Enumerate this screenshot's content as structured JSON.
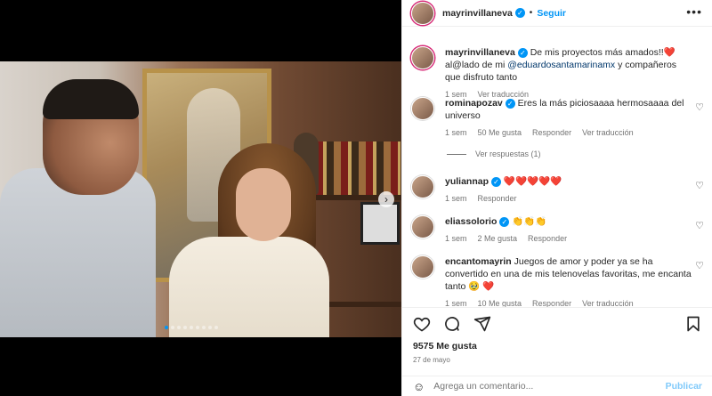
{
  "post": {
    "author": "mayrinvillaneva",
    "follow_label": "Seguir",
    "more_icon": "more-icon",
    "media_dots": 9,
    "active_dot": 0
  },
  "caption": {
    "user": "mayrinvillaneva",
    "text_before": " De mis proyectos más amados!!",
    "heart": "❤️",
    "text_mid": " al@lado de mi ",
    "mention": "@eduardosantamarinamx",
    "text_after": " y compañeros que disfruto tanto",
    "time": "1 sem",
    "translate": "Ver traducción"
  },
  "comments": [
    {
      "user": "rominapozav",
      "verified": true,
      "text": " Eres la más piciosaaaa hermosaaaa del universo",
      "time": "1 sem",
      "likes": "50 Me gusta",
      "reply": "Responder",
      "translate": "Ver traducción",
      "replies": "Ver respuestas (1)"
    },
    {
      "user": "yuliannap",
      "verified": true,
      "text": " ❤️❤️❤️❤️❤️",
      "time": "1 sem",
      "reply": "Responder"
    },
    {
      "user": "eliassolorio",
      "verified": true,
      "text": " 👏👏👏",
      "time": "1 sem",
      "likes": "2 Me gusta",
      "reply": "Responder"
    },
    {
      "user": "encantomayrin",
      "verified": false,
      "text": " Juegos de amor y poder ya se ha convertido en una de mis telenovelas favoritas, me encanta tanto 🥹 ❤️",
      "time": "1 sem",
      "likes": "10 Me gusta",
      "reply": "Responder",
      "translate": "Ver traducción"
    }
  ],
  "stats": {
    "likes": "9575 Me gusta",
    "date": "27 de mayo"
  },
  "composer": {
    "placeholder": "Agrega un comentario...",
    "post_label": "Publicar"
  },
  "colors": {
    "accent": "#0095f6",
    "heart": "#ed2647",
    "muted": "#737373",
    "text": "#262626"
  }
}
